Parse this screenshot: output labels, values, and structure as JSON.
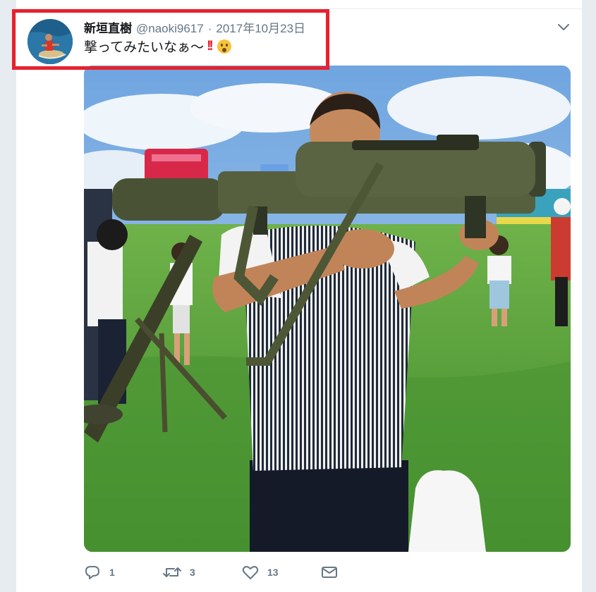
{
  "tweet": {
    "author_name": "新垣直樹",
    "handle": "@naoki9617",
    "separator": "·",
    "date": "2017年10月23日",
    "text": "撃ってみたいなぁ～",
    "emojis": [
      "double-exclamation",
      "astonished-face"
    ],
    "media": {
      "description_icon": "photo"
    }
  },
  "actions": {
    "reply_count": "1",
    "retweet_count": "3",
    "like_count": "13"
  },
  "colors": {
    "background": "#e6ecf0",
    "card": "#ffffff",
    "primary_text": "#14171a",
    "secondary_text": "#657786",
    "highlight_border": "#e8212e"
  },
  "icons": {
    "menu": "chevron-down-icon",
    "reply": "reply-icon",
    "retweet": "retweet-icon",
    "like": "heart-icon",
    "message": "envelope-icon"
  }
}
